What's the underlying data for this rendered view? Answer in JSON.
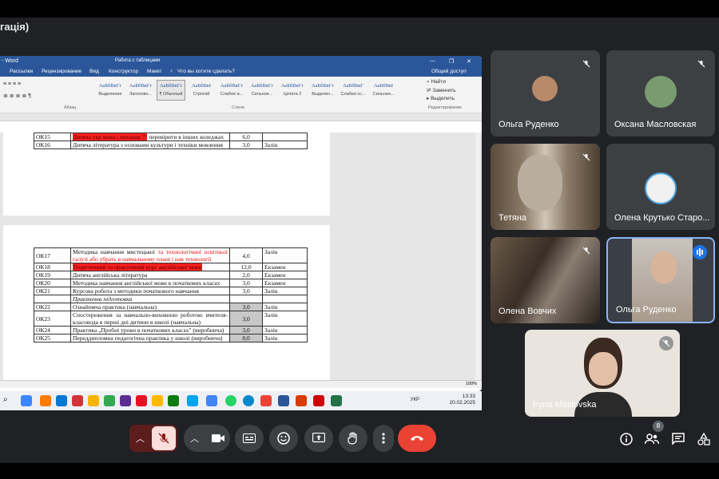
{
  "meeting": {
    "title": "гація)",
    "participant_count": "8"
  },
  "word": {
    "title": "- Word",
    "tools_label": "Работа с таблицами",
    "tabs": [
      "Рассылки",
      "Рецензирование",
      "Вид",
      "Конструктор",
      "Макет"
    ],
    "tell_me": "Что вы хотите сделать?",
    "share": "Общий доступ",
    "styles": [
      {
        "preview": "АаБбВвГг",
        "name": "Выделение"
      },
      {
        "preview": "АаБбВвГг",
        "name": "Заголово..."
      },
      {
        "preview": "АаБбВвГг",
        "name": "¶ Обычный"
      },
      {
        "preview": "АаБбВвІ",
        "name": "Строгий"
      },
      {
        "preview": "АаБбВвГг",
        "name": "Слабое в..."
      },
      {
        "preview": "АаБбВвГг",
        "name": "Сильное..."
      },
      {
        "preview": "АаБбВвГг",
        "name": "Цитата 2"
      },
      {
        "preview": "АаБбВвГг",
        "name": "Выделен..."
      },
      {
        "preview": "АаБбВвГ",
        "name": "Слабая сс..."
      },
      {
        "preview": "АаБбВвІ",
        "name": "Сильная..."
      }
    ],
    "find": "Найти",
    "replace": "Заменить",
    "select": "Выделить",
    "group_paragraph": "Абзац",
    "group_styles": "Стили",
    "group_editing": "Редактирование"
  },
  "table_page1": [
    {
      "code": "ОК15",
      "title_pre": "",
      "title_hl": "Дитяча укр мова і читання ??",
      "title_post": " перевірити в інших коледжах",
      "credits": "6,0",
      "form": ""
    },
    {
      "code": "ОК16",
      "title_pre": "Дитяча література з основами культури і техніки мовлення",
      "title_hl": "",
      "title_post": "",
      "credits": "3,0",
      "form": "Залік"
    }
  ],
  "table_page2": [
    {
      "code": "ОК17",
      "title_pre": "Методика навчання мистецької ",
      "title_red": "та технологічної освітньої галузі або убрать в навчальному плані і нав технології",
      "credits": "4,0",
      "form": "Залік"
    },
    {
      "code": "ОК18",
      "title_hl": "Теоретичний та практичний курс англійської мови",
      "credits": "12,0",
      "form": "Екзамен"
    },
    {
      "code": "ОК19",
      "title_pre": "Дитяча англійська література",
      "credits": "2,0",
      "form": "Екзамен"
    },
    {
      "code": "ОК20",
      "title_pre": "Методика навчання англійської мови в початкових класах",
      "credits": "3,0",
      "form": "Екзамен"
    },
    {
      "code": "ОК21",
      "title_pre": "Курсова робота з методики початкового навчання",
      "credits": "3,0",
      "form": "Залік"
    },
    {
      "code": "",
      "title_italic": "Практична підготовка",
      "credits": "",
      "form": ""
    },
    {
      "code": "ОК22",
      "title_pre": "Ознайомча практика (навчальна)",
      "credits": "3,0",
      "form": "Залік"
    },
    {
      "code": "ОК23",
      "title_pre": "Спостереження за навчально-виховною роботою вчителя-класовода в перші дні дитини в школі (навчальна)",
      "credits": "3,0",
      "form": "Залік"
    },
    {
      "code": "ОК24",
      "title_pre": "Практика „Пробні уроки в початкових класах\" (виробнича)",
      "credits": "3,0",
      "form": "Залік"
    },
    {
      "code": "ОК25",
      "title_pre": "Переддипломна педагогічна практика у школі (виробнича)",
      "credits": "8,0",
      "form": "Залік"
    }
  ],
  "taskbar": {
    "lang": "УКР",
    "time": "13:33",
    "date": "20.02.2025",
    "zoom": "100%"
  },
  "tiles": [
    {
      "name": "Ольга Руденко",
      "muted": true
    },
    {
      "name": "Оксана Масловская",
      "muted": true
    },
    {
      "name": "Тетяна",
      "muted": true
    },
    {
      "name": "Олена Крутько Старо...",
      "muted": true
    },
    {
      "name": "Олена Вовчих",
      "muted": true
    },
    {
      "name": "Ольга Руденко",
      "muted": false
    },
    {
      "name": "Iryna Maslovska",
      "muted": true
    }
  ],
  "colors": {
    "meet_bg": "#202124",
    "tile_bg": "#3c4043",
    "end_call": "#ea4335",
    "mic_off_bg": "#f9dedc",
    "word_blue": "#2b579a",
    "highlight_red": "#ff2020",
    "active_border": "#8ab4f8"
  },
  "icons": [
    "mic-off-icon",
    "camera-icon",
    "captions-icon",
    "emoji-icon",
    "present-icon",
    "raise-hand-icon",
    "more-icon",
    "end-call-icon",
    "info-icon",
    "people-icon",
    "chat-icon",
    "activities-icon"
  ]
}
